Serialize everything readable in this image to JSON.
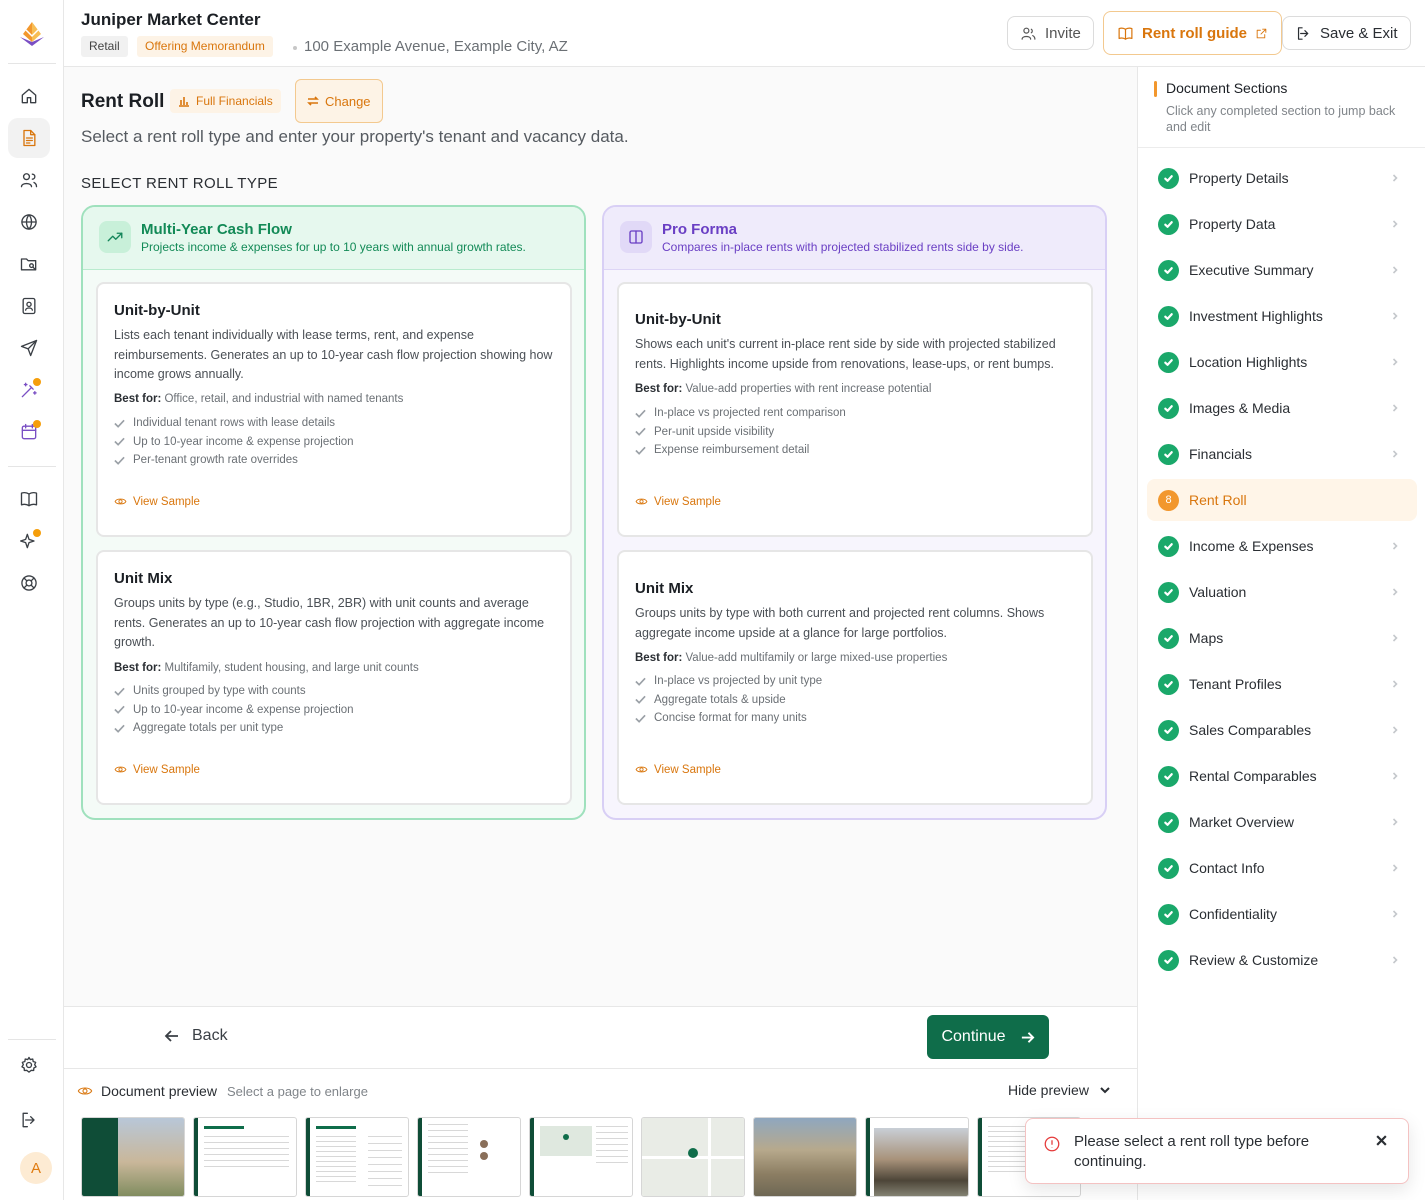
{
  "header": {
    "title": "Juniper Market Center",
    "tags": [
      "Retail",
      "Offering Memorandum"
    ],
    "address": "100 Example Avenue, Example City, AZ",
    "invite_label": "Invite",
    "guide_label": "Rent roll guide",
    "save_exit_label": "Save & Exit"
  },
  "rail": {
    "icons": [
      "home-icon",
      "document-icon",
      "users-icon",
      "globe-icon",
      "folder-icon",
      "contacts-icon",
      "send-icon",
      "magic-wand-icon",
      "calendar-icon",
      "book-icon",
      "sparkles-icon",
      "help-icon",
      "settings-icon",
      "logout-icon"
    ],
    "avatar_initial": "A"
  },
  "main": {
    "title": "Rent Roll",
    "chip_full_financials": "Full Financials",
    "chip_change": "Change",
    "subtitle": "Select a rent roll type and enter your property's tenant and vacancy data.",
    "section_label": "SELECT RENT ROLL TYPE",
    "panels": [
      {
        "title": "Multi-Year Cash Flow",
        "description": "Projects income & expenses for up to 10 years with annual growth rates.",
        "cards": [
          {
            "title": "Unit-by-Unit",
            "description": "Lists each tenant individually with lease terms, rent, and expense reimbursements. Generates an up to 10-year cash flow projection showing how income grows annually.",
            "best_for_label": "Best for:",
            "best_for": "Office, retail, and industrial with named tenants",
            "features": [
              "Individual tenant rows with lease details",
              "Up to 10-year income & expense projection",
              "Per-tenant growth rate overrides"
            ],
            "view_sample": "View Sample"
          },
          {
            "title": "Unit Mix",
            "description": "Groups units by type (e.g., Studio, 1BR, 2BR) with unit counts and average rents. Generates an up to 10-year cash flow projection with aggregate income growth.",
            "best_for_label": "Best for:",
            "best_for": "Multifamily, student housing, and large unit counts",
            "features": [
              "Units grouped by type with counts",
              "Up to 10-year income & expense projection",
              "Aggregate totals per unit type"
            ],
            "view_sample": "View Sample"
          }
        ]
      },
      {
        "title": "Pro Forma",
        "description": "Compares in-place rents with projected stabilized rents side by side.",
        "cards": [
          {
            "title": "Unit-by-Unit",
            "description": "Shows each unit's current in-place rent side by side with projected stabilized rents. Highlights income upside from renovations, lease-ups, or rent bumps.",
            "best_for_label": "Best for:",
            "best_for": "Value-add properties with rent increase potential",
            "features": [
              "In-place vs projected rent comparison",
              "Per-unit upside visibility",
              "Expense reimbursement detail"
            ],
            "view_sample": "View Sample"
          },
          {
            "title": "Unit Mix",
            "description": "Groups units by type with both current and projected rent columns. Shows aggregate income upside at a glance for large portfolios.",
            "best_for_label": "Best for:",
            "best_for": "Value-add multifamily or large mixed-use properties",
            "features": [
              "In-place vs projected by unit type",
              "Aggregate totals & upside",
              "Concise format for many units"
            ],
            "view_sample": "View Sample"
          }
        ]
      }
    ]
  },
  "footer": {
    "back_label": "Back",
    "continue_label": "Continue"
  },
  "preview": {
    "label": "Document preview",
    "hint": "Select a page to enlarge",
    "hide_label": "Hide preview"
  },
  "sidebar": {
    "title": "Document Sections",
    "subtitle": "Click any completed section to jump back and edit",
    "items": [
      {
        "label": "Property Details",
        "status": "complete"
      },
      {
        "label": "Property Data",
        "status": "complete"
      },
      {
        "label": "Executive Summary",
        "status": "complete"
      },
      {
        "label": "Investment Highlights",
        "status": "complete"
      },
      {
        "label": "Location Highlights",
        "status": "complete"
      },
      {
        "label": "Images & Media",
        "status": "complete"
      },
      {
        "label": "Financials",
        "status": "complete"
      },
      {
        "label": "Rent Roll",
        "status": "current",
        "number": "8"
      },
      {
        "label": "Income & Expenses",
        "status": "complete"
      },
      {
        "label": "Valuation",
        "status": "complete"
      },
      {
        "label": "Maps",
        "status": "complete"
      },
      {
        "label": "Tenant Profiles",
        "status": "complete"
      },
      {
        "label": "Sales Comparables",
        "status": "complete"
      },
      {
        "label": "Rental Comparables",
        "status": "complete"
      },
      {
        "label": "Market Overview",
        "status": "complete"
      },
      {
        "label": "Contact Info",
        "status": "complete"
      },
      {
        "label": "Confidentiality",
        "status": "complete"
      },
      {
        "label": "Review & Customize",
        "status": "complete"
      }
    ]
  },
  "toast": {
    "message": "Please select a rent roll type before continuing."
  },
  "colors": {
    "accent_orange": "#d9760d",
    "primary_green": "#0f6d4a",
    "check_green": "#1aa86a",
    "panel_green": "#138a57",
    "panel_purple": "#6a3fc4",
    "error_red": "#e53b3b"
  }
}
